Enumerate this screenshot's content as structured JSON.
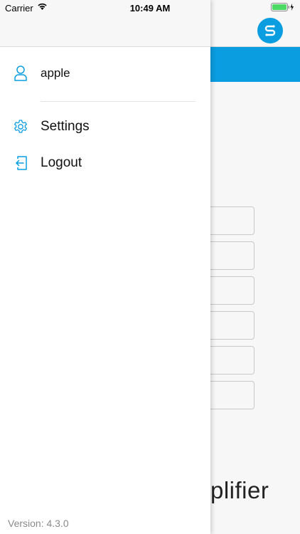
{
  "status_bar": {
    "carrier": "Carrier",
    "time": "10:49 AM"
  },
  "drawer": {
    "user": {
      "name": "apple",
      "icon": "user-icon"
    },
    "items": [
      {
        "label": "Settings",
        "icon": "gear-icon"
      },
      {
        "label": "Logout",
        "icon": "logout-icon"
      }
    ],
    "version": "Version: 4.3.0"
  },
  "background_app": {
    "brand_fragment": "plifier",
    "accent_color": "#0a9de0"
  }
}
